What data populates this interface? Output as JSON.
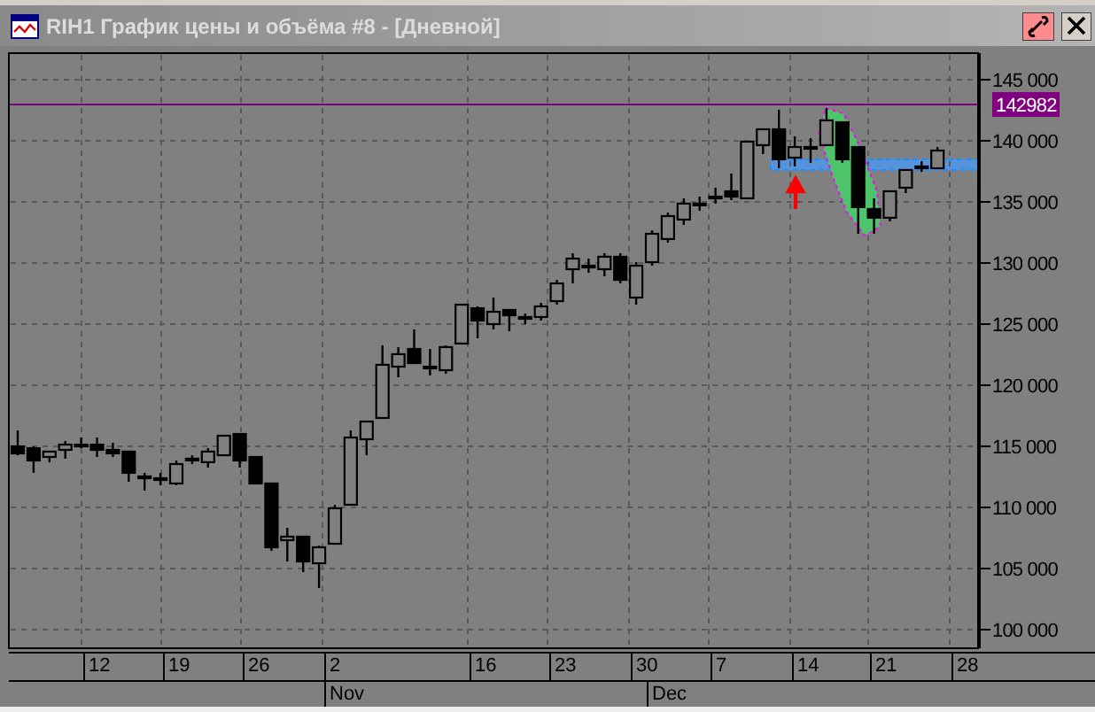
{
  "window": {
    "title": "RIH1 График цены и объёма #8 - [Дневной]"
  },
  "chart": {
    "price_marker": "142982",
    "chart_data": {
      "type": "candlestick",
      "ylim": [
        98480,
        147170
      ],
      "yticks": [
        {
          "value": 145000,
          "label": "145 000"
        },
        {
          "value": 140000,
          "label": "140 000"
        },
        {
          "value": 135000,
          "label": "135 000"
        },
        {
          "value": 130000,
          "label": "130 000"
        },
        {
          "value": 125000,
          "label": "125 000"
        },
        {
          "value": 120000,
          "label": "120 000"
        },
        {
          "value": 115000,
          "label": "115 000"
        },
        {
          "value": 110000,
          "label": "110 000"
        },
        {
          "value": 105000,
          "label": "105 000"
        },
        {
          "value": 100000,
          "label": "100 000"
        }
      ],
      "grid": true,
      "ohlc": [
        [
          115000,
          116300,
          114270,
          114420
        ],
        [
          114850,
          115000,
          112830,
          113840
        ],
        [
          114130,
          114570,
          113700,
          114570
        ],
        [
          114710,
          115430,
          113990,
          115140
        ],
        [
          115140,
          115720,
          114850,
          115140
        ],
        [
          115140,
          115720,
          114130,
          114710
        ],
        [
          114710,
          115290,
          114130,
          114420
        ],
        [
          114570,
          114570,
          112100,
          112830
        ],
        [
          112540,
          112830,
          111380,
          112390
        ],
        [
          112390,
          112830,
          111810,
          112250
        ],
        [
          111960,
          113840,
          111810,
          113550
        ],
        [
          113990,
          114270,
          113550,
          113990
        ],
        [
          113700,
          114850,
          113260,
          114570
        ],
        [
          114270,
          115870,
          114270,
          115870
        ],
        [
          116010,
          116010,
          113260,
          113840
        ],
        [
          114130,
          114130,
          111960,
          111960
        ],
        [
          111960,
          111960,
          106450,
          106740
        ],
        [
          107320,
          108330,
          105580,
          107610
        ],
        [
          107610,
          107610,
          104710,
          105580
        ],
        [
          105430,
          106880,
          103410,
          106740
        ],
        [
          107030,
          110220,
          107030,
          109930
        ],
        [
          110220,
          116300,
          110220,
          115720
        ],
        [
          115580,
          117030,
          114270,
          117030
        ],
        [
          117320,
          123260,
          117320,
          121670
        ],
        [
          121520,
          123120,
          120650,
          122540
        ],
        [
          122970,
          124570,
          121810,
          121810
        ],
        [
          121520,
          122970,
          120800,
          121520
        ],
        [
          121230,
          123260,
          120940,
          123120
        ],
        [
          123410,
          126590,
          123410,
          126590
        ],
        [
          126300,
          126450,
          123840,
          125290
        ],
        [
          125000,
          127170,
          124570,
          126010
        ],
        [
          126160,
          126160,
          124420,
          125720
        ],
        [
          125580,
          125870,
          125000,
          125580
        ],
        [
          125580,
          126740,
          125290,
          126450
        ],
        [
          126880,
          128620,
          126590,
          128330
        ],
        [
          129490,
          130800,
          128330,
          130360
        ],
        [
          129780,
          130360,
          129200,
          129780
        ],
        [
          129490,
          130800,
          128910,
          130510
        ],
        [
          130510,
          130800,
          128330,
          128620
        ],
        [
          127170,
          130070,
          126590,
          129780
        ],
        [
          130070,
          132680,
          129780,
          132390
        ],
        [
          131960,
          134130,
          131670,
          133840
        ],
        [
          133550,
          135290,
          133120,
          134860
        ],
        [
          134860,
          135430,
          134280,
          134860
        ],
        [
          135430,
          136160,
          134860,
          135430
        ],
        [
          135870,
          137320,
          135140,
          135430
        ],
        [
          135290,
          139930,
          135290,
          139930
        ],
        [
          139640,
          140940,
          138910,
          140940
        ],
        [
          140940,
          142540,
          137750,
          138480
        ],
        [
          138620,
          140360,
          137900,
          139490
        ],
        [
          139490,
          140220,
          138190,
          139490
        ],
        [
          139640,
          142680,
          139640,
          141670
        ],
        [
          141520,
          141520,
          138190,
          138480
        ],
        [
          139490,
          139490,
          132390,
          134570
        ],
        [
          134420,
          135290,
          132390,
          133700
        ],
        [
          133700,
          135870,
          133410,
          135870
        ],
        [
          136160,
          137610,
          135720,
          137610
        ],
        [
          137900,
          138330,
          137460,
          137900
        ],
        [
          137750,
          139490,
          137750,
          139200
        ]
      ]
    }
  },
  "date_axis": {
    "days": [
      "12",
      "19",
      "26",
      "2",
      "16",
      "23",
      "30",
      "7",
      "14",
      "21",
      "28"
    ],
    "months": [
      "Nov",
      "Dec"
    ]
  }
}
